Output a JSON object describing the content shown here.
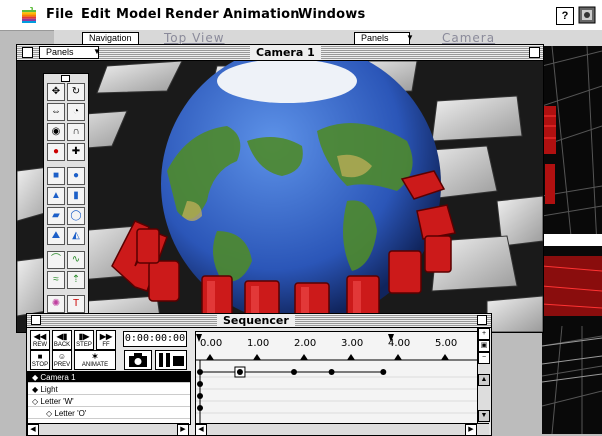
{
  "menubar": {
    "items": [
      "File",
      "Edit",
      "Model",
      "Render",
      "Animation",
      "Windows"
    ],
    "help_icon": "?"
  },
  "bg_window": {
    "nav_button": "Navigation",
    "title": "Top View",
    "panels_button": "Panels",
    "camera_title": "Camera"
  },
  "camera_window": {
    "title": "Camera 1",
    "panels_button": "Panels",
    "palette_tools": [
      "move-icon",
      "rotate-icon",
      "scale-icon",
      "orbit-icon",
      "select-icon",
      "magnet-icon",
      "sphere-red-icon",
      "lasso-icon",
      "cube-icon",
      "sphere-icon",
      "cone-icon",
      "cylinder-icon",
      "plane-icon",
      "torus-icon",
      "terrain-icon",
      "pyramid-icon",
      "bend-icon",
      "twist-icon",
      "light-icon",
      "text-icon"
    ]
  },
  "scene": {
    "logo_letters": [
      "W",
      "O",
      "R",
      "L",
      "D",
      "B",
      "U",
      "I",
      "L",
      "D",
      "E",
      "R"
    ],
    "colors": {
      "ocean": "#2f62c8",
      "land": "#4e8a2c",
      "letters": "#cc1a1a",
      "tile": "#d8d8d8",
      "floor": "#1a1a1a"
    }
  },
  "sequencer": {
    "title": "Sequencer",
    "transport": [
      {
        "icon": "rewind-icon",
        "glyph": "◀◀",
        "label": "REW"
      },
      {
        "icon": "step-back-icon",
        "glyph": "◀▮",
        "label": "BACK"
      },
      {
        "icon": "step-forward-icon",
        "glyph": "▮▶",
        "label": "STEP"
      },
      {
        "icon": "fast-forward-icon",
        "glyph": "▶▶",
        "label": "FF"
      },
      {
        "icon": "stop-icon",
        "glyph": "■",
        "label": "STOP"
      },
      {
        "icon": "preview-icon",
        "glyph": "☺",
        "label": "PREV"
      },
      {
        "icon": "animate-icon",
        "glyph": "✶",
        "label": "ANIMATE"
      }
    ],
    "timecode": "0:00:00:00",
    "ticks": [
      "0.00",
      "1.00",
      "2.00",
      "3.00",
      "4.00",
      "5.00"
    ],
    "tracks": [
      {
        "label": "Camera 1",
        "prefix": "◆",
        "selected": true
      },
      {
        "label": "Light",
        "prefix": "◆",
        "selected": false
      },
      {
        "label": "Letter 'W'",
        "prefix": "◇",
        "selected": false
      },
      {
        "label": "Letter 'O'",
        "prefix": "◇",
        "selected": false
      }
    ],
    "keyframe_times": [
      0,
      0.85,
      2.0,
      2.8,
      3.9
    ]
  }
}
